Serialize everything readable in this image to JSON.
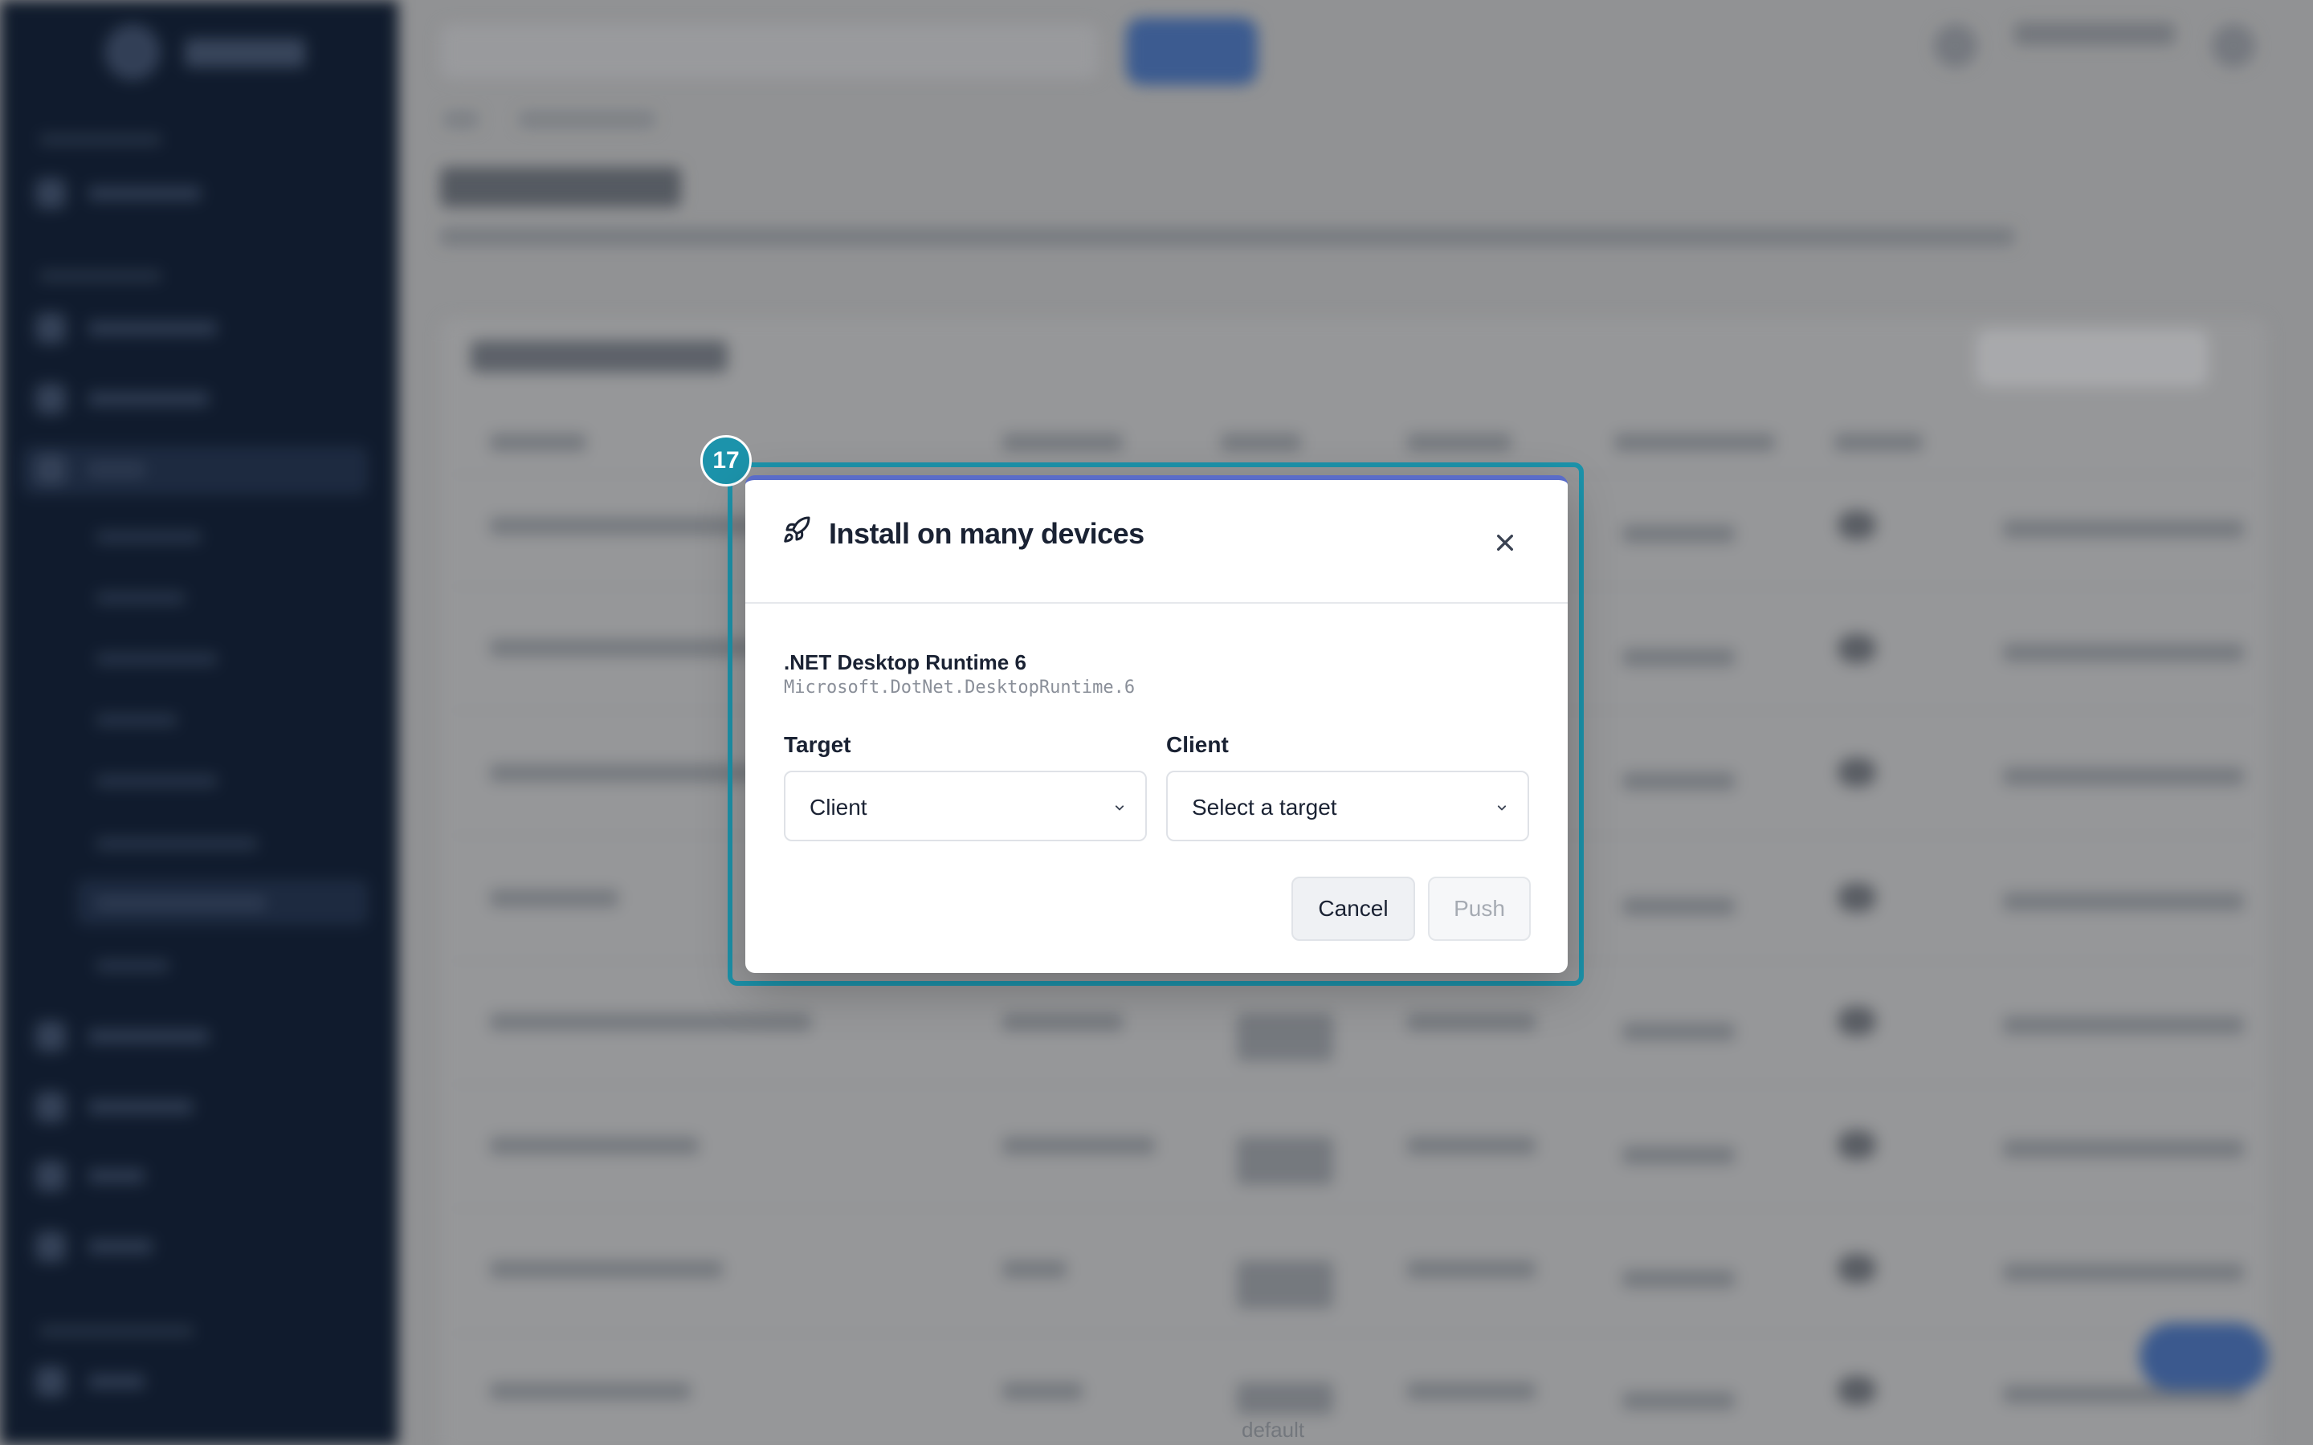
{
  "badge": {
    "number": "17"
  },
  "dialog": {
    "title": "Install on many devices",
    "icon": "rocket-icon",
    "close_icon": "close-icon",
    "package": {
      "name": ".NET Desktop Runtime 6",
      "id": "Microsoft.DotNet.DesktopRuntime.6"
    },
    "target_label": "Target",
    "target_value": "Client",
    "client_label": "Client",
    "client_value": "Select a target",
    "cancel_label": "Cancel",
    "push_label": "Push"
  },
  "background": {
    "faint_text": "default"
  },
  "colors": {
    "accent": "#5a6cc9",
    "highlight": "#1c93ab",
    "sidebar": "#0f1a2d"
  }
}
